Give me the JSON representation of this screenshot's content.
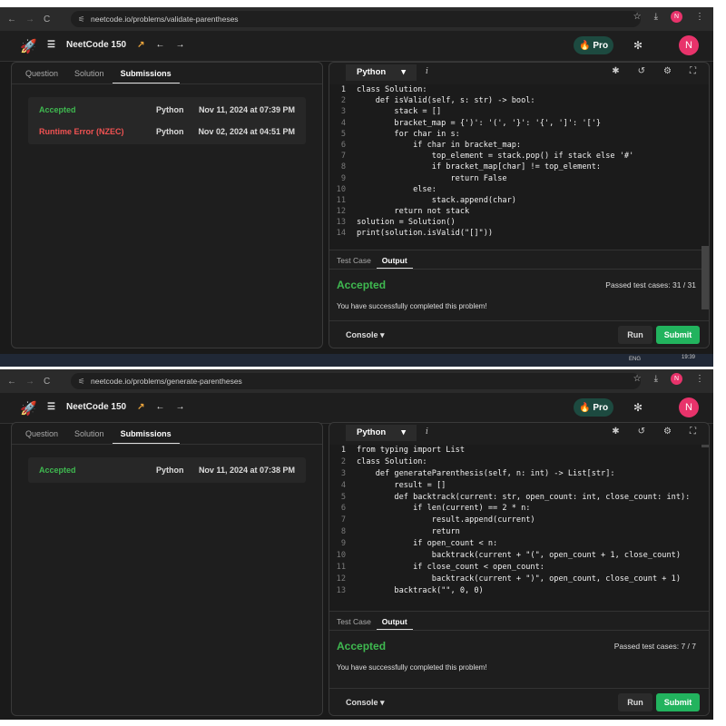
{
  "screens": [
    {
      "url": "neetcode.io/problems/validate-parentheses",
      "app_title": "NeetCode 150",
      "pro_label": "Pro",
      "avatar": "N",
      "tabs": [
        "Question",
        "Solution",
        "Submissions"
      ],
      "submissions": [
        {
          "status": "Accepted",
          "language": "Python",
          "date": "Nov 11, 2024 at 07:39 PM",
          "color": "green"
        },
        {
          "status": "Runtime Error (NZEC)",
          "language": "Python",
          "date": "Nov 02, 2024 at 04:51 PM",
          "color": "red"
        }
      ],
      "language": "Python",
      "code": [
        "class Solution:",
        "    def isValid(self, s: str) -> bool:",
        "        stack = []",
        "        bracket_map = {')': '(', '}': '{', ']': '['}",
        "        for char in s:",
        "            if char in bracket_map:",
        "                top_element = stack.pop() if stack else '#'",
        "                if bracket_map[char] != top_element:",
        "                    return False",
        "            else:",
        "                stack.append(char)",
        "        return not stack",
        "solution = Solution()",
        "print(solution.isValid(\"[]\"))"
      ],
      "output_tabs": [
        "Test Case",
        "Output"
      ],
      "result": "Accepted",
      "passed": "Passed test cases: 31 / 31",
      "message": "You have successfully completed this problem!",
      "console": "Console",
      "run": "Run",
      "submit": "Submit",
      "taskbar": {
        "lang": "ENG",
        "time": "19:39"
      }
    },
    {
      "url": "neetcode.io/problems/generate-parentheses",
      "app_title": "NeetCode 150",
      "pro_label": "Pro",
      "avatar": "N",
      "tabs": [
        "Question",
        "Solution",
        "Submissions"
      ],
      "submissions": [
        {
          "status": "Accepted",
          "language": "Python",
          "date": "Nov 11, 2024 at 07:38 PM",
          "color": "green"
        }
      ],
      "language": "Python",
      "code": [
        "from typing import List",
        "class Solution:",
        "    def generateParenthesis(self, n: int) -> List[str]:",
        "        result = []",
        "        def backtrack(current: str, open_count: int, close_count: int):",
        "            if len(current) == 2 * n:",
        "                result.append(current)",
        "                return",
        "            if open_count < n:",
        "                backtrack(current + \"(\", open_count + 1, close_count)",
        "            if close_count < open_count:",
        "                backtrack(current + \")\", open_count, close_count + 1)",
        "        backtrack(\"\", 0, 0)"
      ],
      "output_tabs": [
        "Test Case",
        "Output"
      ],
      "result": "Accepted",
      "passed": "Passed test cases: 7 / 7",
      "message": "You have successfully completed this problem!",
      "console": "Console",
      "run": "Run",
      "submit": "Submit"
    }
  ],
  "colors": {
    "accent": "#22b35e",
    "accepted": "#3fb950",
    "error": "#f05252",
    "avatar": "#e8336b"
  }
}
